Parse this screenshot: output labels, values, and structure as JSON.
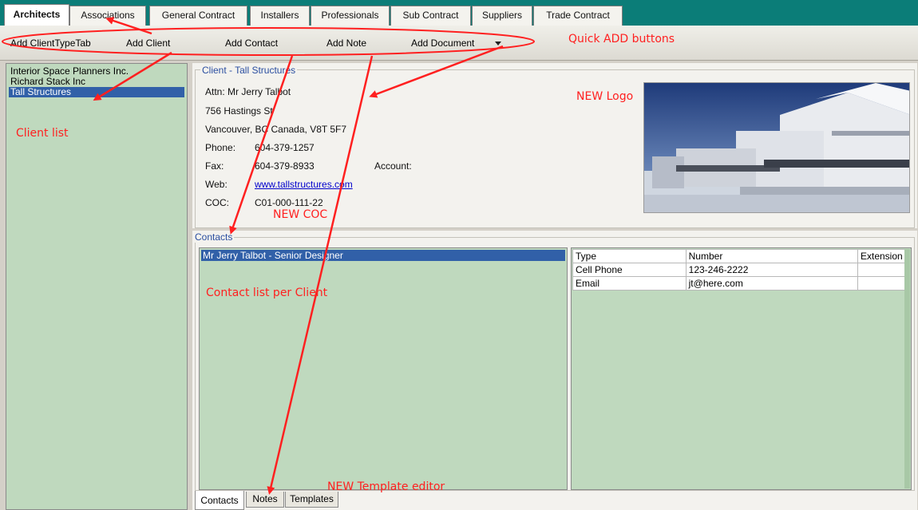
{
  "tabs": [
    {
      "label": "Architects",
      "active": true
    },
    {
      "label": "Associations"
    },
    {
      "label": "General Contract"
    },
    {
      "label": "Installers"
    },
    {
      "label": "Professionals"
    },
    {
      "label": "Sub Contract"
    },
    {
      "label": "Suppliers"
    },
    {
      "label": "Trade Contract"
    }
  ],
  "toolbar": {
    "add_clienttypetab": "Add ClientTypeTab",
    "add_client": "Add Client",
    "add_contact": "Add Contact",
    "add_note": "Add Note",
    "add_document": "Add Document"
  },
  "clients": [
    {
      "name": "Interior Space Planners Inc."
    },
    {
      "name": "Richard Stack Inc"
    },
    {
      "name": "Tall Structures",
      "selected": true
    }
  ],
  "client": {
    "legend": "Client - Tall Structures",
    "attn": "Attn: Mr Jerry Talbot",
    "street": "756 Hastings St",
    "city": "Vancouver, BC  Canada,  V8T 5F7",
    "phone_label": "Phone:",
    "phone": "604-379-1257",
    "fax_label": "Fax:",
    "fax": "604-379-8933",
    "account_label": "Account:",
    "web_label": "Web:",
    "web": "www.tallstructures.com",
    "coc_label": "COC:",
    "coc": "C01-000-111-22"
  },
  "contacts": {
    "legend": "Contacts",
    "items": [
      "Mr Jerry Talbot - Senior Designer"
    ],
    "numbers_columns": [
      "Type",
      "Number",
      "Extension"
    ],
    "numbers_rows": [
      [
        "Cell Phone",
        "123-246-2222",
        ""
      ],
      [
        "Email",
        "jt@here.com",
        ""
      ]
    ]
  },
  "bottom_tabs": [
    {
      "label": "Contacts",
      "active": true
    },
    {
      "label": "Notes"
    },
    {
      "label": "Templates"
    }
  ],
  "annotations": {
    "quick_add": "Quick ADD buttons",
    "client_list": "Client list",
    "new_logo": "NEW Logo",
    "new_coc": "NEW COC",
    "contact_list": "Contact list per Client",
    "template_editor": "NEW Template editor"
  },
  "colors": {
    "annotation": "#ff2020",
    "selection": "#3160a8",
    "list_bg": "#bfd9be",
    "tab_strip": "#0b7d78"
  }
}
